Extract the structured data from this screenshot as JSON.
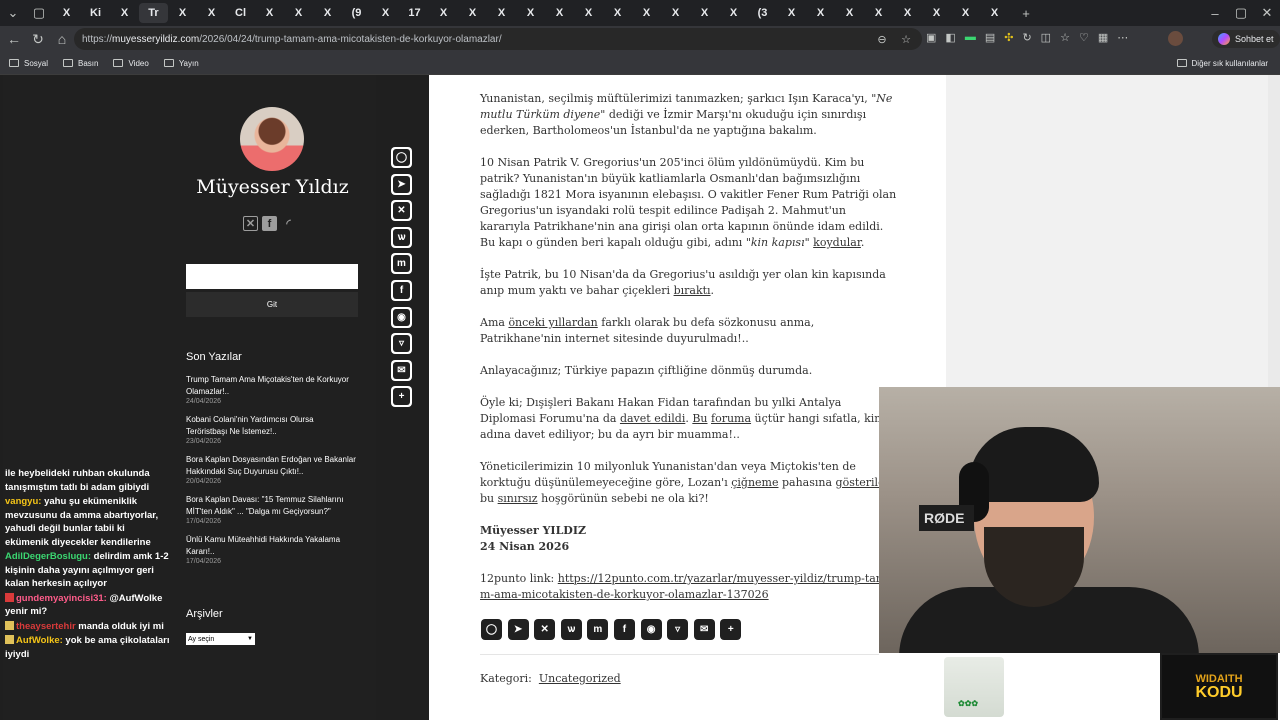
{
  "browser": {
    "tabs": [
      "X",
      "Ki",
      "X",
      "X",
      "X",
      "Cl",
      "X",
      "X",
      "X",
      "(9",
      "X",
      "17",
      "X",
      "X",
      "X",
      "X",
      "X",
      "X",
      "X",
      "X",
      "X",
      "X",
      "X",
      "(3",
      "X",
      "X",
      "X",
      "X",
      "X",
      "X",
      "X",
      "X"
    ],
    "active_tab_label": "Tr",
    "url_prefix": "https://",
    "url_host": "muyesseryildiz.com",
    "url_path": "/2026/04/24/trump-tamam-ama-micotakisten-de-korkuyor-olamazlar/",
    "chat_button": "Sohbet et",
    "bookmarks": [
      "Sosyal",
      "Basın",
      "Video",
      "Yayın"
    ],
    "other_bookmarks": "Diğer sık kullanılanlar"
  },
  "sidebar": {
    "site_title": "Müyesser Yıldız",
    "search_button": "Git",
    "recent_title": "Son Yazılar",
    "posts": [
      {
        "title": "Trump Tamam Ama Miçotakis'ten de Korkuyor Olamazlar!..",
        "date": "24/04/2026"
      },
      {
        "title": "Kobani Colani'nin Yardımcısı Olursa Teröristbaşı Ne İstemez!..",
        "date": "23/04/2026"
      },
      {
        "title": "Bora Kaplan Dosyasından Erdoğan ve Bakanlar Hakkındaki Suç Duyurusu Çıktı!..",
        "date": "20/04/2026"
      },
      {
        "title": "Bora Kaplan Davası: \"15 Temmuz Silahlarını MİT'ten Aldık\" ... \"Dalga mı Geçiyorsun?\"",
        "date": "17/04/2026"
      },
      {
        "title": "Ünlü Kamu Müteahhidi Hakkında Yakalama Kararı!..",
        "date": "17/04/2026"
      }
    ],
    "archive_title": "Arşivler",
    "archive_select": "Ay seçin"
  },
  "chat": [
    {
      "user": "",
      "text": "ile heybelideki ruhban okulunda tanışmıştım tatlı bi adam gibiydi",
      "color": "#ffffff"
    },
    {
      "user": "vangyu:",
      "text": " yahu şu ekümeniklik mevzusunu da amma abartıyorlar, yahudi değil bunlar tabii ki ekümenik diyecekler kendilerine",
      "color": "#f5c518"
    },
    {
      "user": "AdilDegerBoslugu:",
      "text": " delirdim amk 1-2 kişinin daha yayını açılmıyor geri kalan herkesin açılıyor",
      "color": "#3bd671"
    },
    {
      "user": "gundemyayincisi31:",
      "text": " @AufWolke yenir mi?",
      "color": "#ff5c8a"
    },
    {
      "user": "theaysertehir",
      "text": " manda olduk iyi mi",
      "color": "#d93a3a"
    },
    {
      "user": "AufWolke:",
      "text": " yok be ama çikolataları iyiydi",
      "color": "#f5c518"
    }
  ],
  "article": {
    "p1_a": "Yunanistan, seçilmiş müftülerimizi tanımazken; şarkıcı Işın Karaca'yı, ",
    "p1_q": "\"Ne mutlu Türküm diyene\"",
    "p1_b": " dediği ve İzmir Marşı'nı okuduğu için sınırdışı ederken, Bartholomeos'un İstanbul'da ne yaptığına bakalım.",
    "p2_a": "10 Nisan Patrik V. Gregorius'un 205'inci ölüm yıldönümüydü. Kim bu patrik? Yunanistan'ın büyük katliamlarla Osmanlı'dan bağımsızlığını sağladığı 1821 Mora isyanının elebaşısı. O vakitler Fener Rum Patriği olan Gregorius'un isyandaki rolü tespit edilince Padişah 2. Mahmut'un kararıyla Patrikhane'nin ana girişi olan orta kapının önünde idam edildi. Bu kapı o günden beri kapalı olduğu gibi, adını ",
    "p2_q": "\"kin kapısı\"",
    "p2_link": "koydular",
    "p2_end": ".",
    "p3_a": "İşte Patrik, bu 10 Nisan'da da Gregorius'u asıldığı yer olan kin kapısında anıp mum yaktı ve bahar çiçekleri ",
    "p3_link": "bıraktı",
    "p3_end": ".",
    "p4_a": "Ama ",
    "p4_link": "önceki yıllardan",
    "p4_b": " farklı olarak bu defa sözkonusu anma, Patrikhane'nin internet sitesinde duyurulmadı!..",
    "p5": "Anlayacağınız; Türkiye papazın çiftliğine dönmüş durumda.",
    "p6_a": "Öyle ki; Dışişleri Bakanı Hakan Fidan tarafından bu yılki Antalya Diplomasi Forumu'na da ",
    "p6_link1": "davet edildi",
    "p6_b": ". ",
    "p6_link2": "Bu",
    "p6_c": " ",
    "p6_link3": "foruma",
    "p6_d": " üçtür hangi sıfatla, kimin adına davet ediliyor; bu da ayrı bir muamma!..",
    "p7_a": "Yöneticilerimizin 10 milyonluk Yunanistan'dan veya Miçtokis'ten de korktuğu düşünülemeyeceğine göre, Lozan'ı ",
    "p7_link1": "çiğneme",
    "p7_b": " pahasına ",
    "p7_link2": "gösterilen",
    "p7_c": " bu ",
    "p7_link3": "sınırsız",
    "p7_d": " hoşgörünün sebebi ne ola ki?!",
    "author": "Müyesser YILDIZ",
    "date": "24 Nisan 2026",
    "source_label": "12punto link: ",
    "source_link": "https://12punto.com.tr/yazarlar/muyesser-yildiz/trump-tamam-ama-micotakisten-de-korkuyor-olamazlar-137026",
    "category_label": "Kategori:",
    "category": "Uncategorized"
  },
  "overlay": {
    "mic_brand": "RØDE",
    "logo_line1": "WIDAITH",
    "logo_line2": "KODU"
  }
}
